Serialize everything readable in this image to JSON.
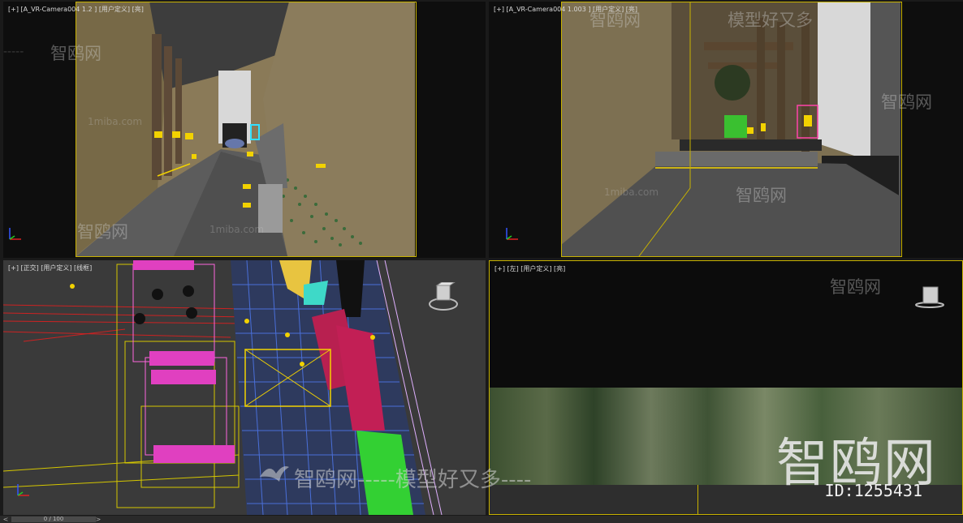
{
  "viewports": {
    "top_left": {
      "label": "[+] [A_VR-Camera004  1.2 ] [用户定义] [亮]"
    },
    "top_right": {
      "label": "[+] [A_VR-Camera004  1.003 ] [用户定义] [亮]"
    },
    "bottom_left": {
      "label": "[+] [正交] [用户定义] [线框]"
    },
    "bottom_right": {
      "label": "[+] [左] [用户定义] [亮]"
    }
  },
  "watermarks": {
    "brand": "智鸥网",
    "dashes": "-----",
    "slogan": "模型好又多",
    "site": "1miba.com",
    "banner": "智鸥网-----模型好又多----"
  },
  "logo": {
    "text": "智鸥网"
  },
  "id_label": "ID:1255431",
  "timeline": {
    "frame": "0 / 100"
  },
  "icons": [
    "axis-gizmo-icon",
    "viewcube-icon",
    "bird-logo-icon",
    "prev-frame-icon",
    "next-frame-icon"
  ]
}
